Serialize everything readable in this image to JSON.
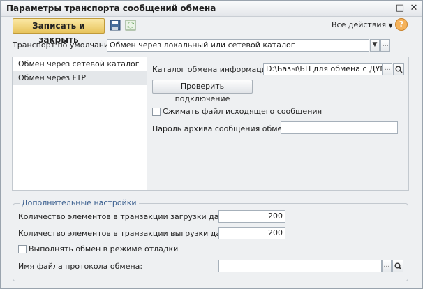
{
  "window": {
    "title": "Параметры транспорта сообщений обмена",
    "controls": {
      "minimize": "□",
      "close": "✕"
    }
  },
  "toolbar": {
    "save_close_label": "Записать и закрыть",
    "actions_label": "Все действия",
    "help_label": "?"
  },
  "default_transport": {
    "label": "Транспорт по умолчанию:",
    "value": "Обмен через локальный или сетевой каталог"
  },
  "transport_list": {
    "items": [
      {
        "label": "Обмен через сетевой каталог"
      },
      {
        "label": "Обмен через FTP"
      }
    ]
  },
  "directory": {
    "label": "Каталог обмена информацией:",
    "value": "D:\\Базы\\БП для обмена с ДУМ"
  },
  "check_connection_label": "Проверить подключение",
  "compress": {
    "label": "Сжимать файл исходящего сообщения",
    "checked": false
  },
  "archive_password": {
    "label": "Пароль архива сообщения обмена:",
    "value": ""
  },
  "additional": {
    "title": "Дополнительные настройки",
    "load_count_label": "Количество элементов в транзакции загрузки данных:",
    "load_count_value": "200",
    "unload_count_label": "Количество элементов в транзакции выгрузки данных:",
    "unload_count_value": "200",
    "debug_label": "Выполнять обмен в режиме отладки",
    "debug_checked": false,
    "log_file_label": "Имя файла протокола обмена:",
    "log_file_value": ""
  },
  "icons": {
    "save": "floppy-icon",
    "refresh": "refresh-icon",
    "dropdown": "triangle-down",
    "select": "ellipsis",
    "open": "magnifier"
  },
  "colors": {
    "save_button": "#e8c45c",
    "group_title": "#3a5f8f",
    "window_bg": "#eef0f2"
  }
}
